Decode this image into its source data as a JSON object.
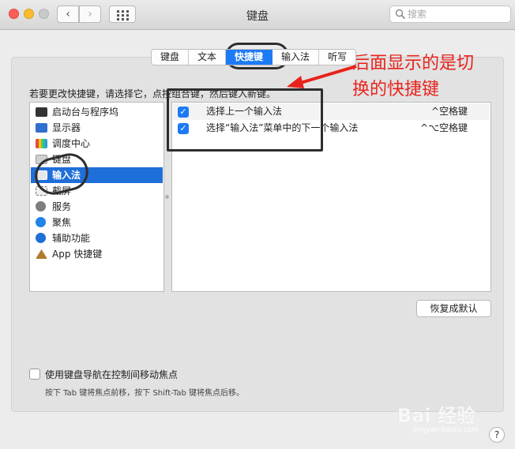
{
  "window": {
    "title": "键盘"
  },
  "search": {
    "placeholder": "搜索"
  },
  "tabs": [
    {
      "label": "键盘",
      "active": false
    },
    {
      "label": "文本",
      "active": false
    },
    {
      "label": "快捷键",
      "active": true
    },
    {
      "label": "输入法",
      "active": false
    },
    {
      "label": "听写",
      "active": false
    }
  ],
  "instruction": "若要更改快捷键，请选择它，点按组合键，然后键入新键。",
  "categories": [
    {
      "label": "启动台与程序坞",
      "icon": "launchpad-icon",
      "color": "#333333"
    },
    {
      "label": "显示器",
      "icon": "display-icon",
      "color": "#2f6fcf"
    },
    {
      "label": "调度中心",
      "icon": "mission-control-icon",
      "color": "#3a3a3a"
    },
    {
      "label": "键盘",
      "icon": "keyboard-icon",
      "color": "#9a9a9a"
    },
    {
      "label": "输入法",
      "icon": "keyboard-icon",
      "color": "#e6e6e6",
      "selected": true
    },
    {
      "label": "截屏",
      "icon": "screenshot-icon",
      "color": "#8a8a8a"
    },
    {
      "label": "服务",
      "icon": "gear-icon",
      "color": "#7d7d7d"
    },
    {
      "label": "聚焦",
      "icon": "spotlight-icon",
      "color": "#1f84e6"
    },
    {
      "label": "辅助功能",
      "icon": "accessibility-icon",
      "color": "#1f6fd6"
    },
    {
      "label": "App 快捷键",
      "icon": "app-shortcut-icon",
      "color": "#b07a2e"
    }
  ],
  "shortcuts": [
    {
      "label": "选择上一个输入法",
      "key": "^空格键",
      "checked": true
    },
    {
      "label": "选择“输入法”菜单中的下一个输入法",
      "key": "^⌥空格键",
      "checked": true
    }
  ],
  "buttons": {
    "restore_defaults": "恢复成默认"
  },
  "keyboard_nav": {
    "label": "使用键盘导航在控制间移动焦点",
    "hint": "按下 Tab 键将焦点前移，按下 Shift-Tab 键将焦点后移。",
    "checked": false
  },
  "help": "?",
  "annotation": {
    "line1": "后面显示的是切",
    "line2": "换的快捷键"
  },
  "watermark": {
    "brand": "Bai 经验",
    "url": "jingyan.baidu.com"
  },
  "colors": {
    "accent": "#1d7af5",
    "selection": "#1e6fd9",
    "annotation": "#e8231c"
  }
}
